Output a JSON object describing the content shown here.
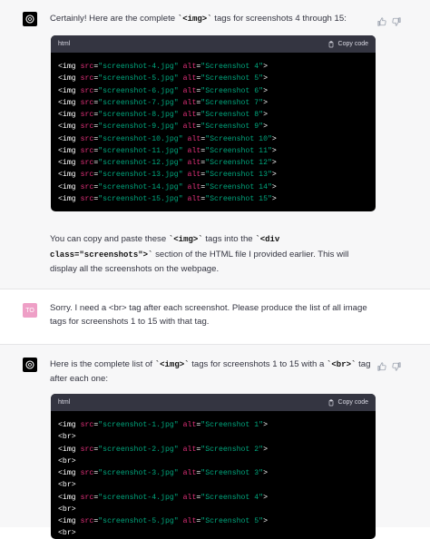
{
  "messages": [
    {
      "role": "assistant",
      "intro": [
        "Certainly! Here are the complete ",
        "<img>",
        " tags for screenshots 4 through 15:"
      ],
      "code_lang": "html",
      "copy_label": "Copy code",
      "lines": [
        [
          "screenshot-4.jpg",
          "Screenshot 4"
        ],
        [
          "screenshot-5.jpg",
          "Screenshot 5"
        ],
        [
          "screenshot-6.jpg",
          "Screenshot 6"
        ],
        [
          "screenshot-7.jpg",
          "Screenshot 7"
        ],
        [
          "screenshot-8.jpg",
          "Screenshot 8"
        ],
        [
          "screenshot-9.jpg",
          "Screenshot 9"
        ],
        [
          "screenshot-10.jpg",
          "Screenshot 10"
        ],
        [
          "screenshot-11.jpg",
          "Screenshot 11"
        ],
        [
          "screenshot-12.jpg",
          "Screenshot 12"
        ],
        [
          "screenshot-13.jpg",
          "Screenshot 13"
        ],
        [
          "screenshot-14.jpg",
          "Screenshot 14"
        ],
        [
          "screenshot-15.jpg",
          "Screenshot 15"
        ]
      ],
      "outro": [
        "You can copy and paste these ",
        "<img>",
        " tags into the ",
        "<div class=\"screenshots\">",
        " section of the HTML file I provided earlier. This will display all the screenshots on the webpage."
      ]
    },
    {
      "role": "user",
      "avatar": "TO",
      "text": "Sorry. I need a <br> tag after each screenshot. Please produce the list of all image tags for screenshots 1 to 15 with that tag."
    },
    {
      "role": "assistant",
      "intro": [
        "Here is the complete list of ",
        "<img>",
        " tags for screenshots 1 to 15 with a ",
        "<br>",
        " tag after each one:"
      ],
      "code_lang": "html",
      "copy_label": "Copy code",
      "lines": [
        [
          "screenshot-1.jpg",
          "Screenshot 1"
        ],
        [
          "screenshot-2.jpg",
          "Screenshot 2"
        ],
        [
          "screenshot-3.jpg",
          "Screenshot 3"
        ],
        [
          "screenshot-4.jpg",
          "Screenshot 4"
        ],
        [
          "screenshot-5.jpg",
          "Screenshot 5"
        ]
      ],
      "br": "<br>"
    }
  ]
}
